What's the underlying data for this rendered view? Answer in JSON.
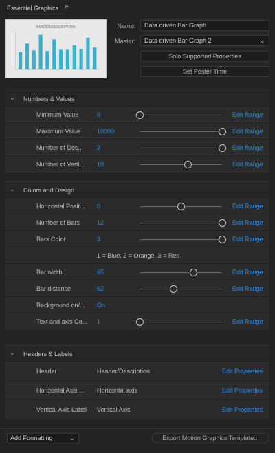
{
  "panel": {
    "title": "Essential Graphics",
    "menu_icon": "hamburger-icon"
  },
  "thumbnail": {
    "title": "HEADER/DESCRIPTION",
    "bars_color": "#3ab0cf",
    "bar_values": [
      30,
      45,
      33,
      60,
      32,
      52,
      34,
      34,
      42,
      35,
      55,
      38
    ]
  },
  "fields": {
    "name_label": "Name:",
    "name_value": "Data driven Bar Graph",
    "master_label": "Master:",
    "master_value": "Data driven Bar Graph 2",
    "solo_button": "Solo Supported Properties",
    "poster_button": "Set Poster Time"
  },
  "sections": [
    {
      "title": "Numbers & Values",
      "rows": [
        {
          "name": "Minimum Value",
          "value": "0",
          "slider": 0.0,
          "link": "Edit Range"
        },
        {
          "name": "Maximum Value",
          "value": "10000",
          "slider": 1.0,
          "link": "Edit Range"
        },
        {
          "name": "Number of Dec...",
          "value": "2",
          "slider": 1.0,
          "link": "Edit Range"
        },
        {
          "name": "Number of Verti...",
          "value": "10",
          "slider": 0.58,
          "link": "Edit Range"
        }
      ]
    },
    {
      "title": "Colors and Design",
      "rows": [
        {
          "name": "Horizontal Posit...",
          "value": "0",
          "slider": 0.5,
          "link": "Edit Range"
        },
        {
          "name": "Number of Bars",
          "value": "12",
          "slider": 1.0,
          "link": "Edit Range"
        },
        {
          "name": "Bars Color",
          "value": "3",
          "slider": 1.0,
          "link": "Edit Range"
        },
        {
          "note": "1 = Blue,  2 = Orange,  3 = Red"
        },
        {
          "name": "Bar width",
          "value": "65",
          "slider": 0.65,
          "link": "Edit Range"
        },
        {
          "name": "Bar distance",
          "value": "62",
          "slider": 0.41,
          "link": "Edit Range"
        },
        {
          "name": "Background on/...",
          "value": "On"
        },
        {
          "name": "Text and axis Co...",
          "value": "1",
          "slider": 0.0,
          "link": "Edit Range"
        }
      ]
    },
    {
      "title": "Headers & Labels",
      "rows": [
        {
          "name": "Header",
          "text": "Header/Description",
          "link": "Edit Properties"
        },
        {
          "name": "Horizontal Axis ...",
          "text": "Horizontal axis",
          "link": "Edit Properties"
        },
        {
          "name": "Vertical Axis Label",
          "text": "Vertical Axis",
          "link": "Edit Properties"
        }
      ]
    }
  ],
  "footer": {
    "add_formatting": "Add Formatting",
    "export": "Export Motion Graphics Template..."
  },
  "colors": {
    "link": "#2d8ceb",
    "background": "#232323",
    "row": "#2b2b2b"
  }
}
